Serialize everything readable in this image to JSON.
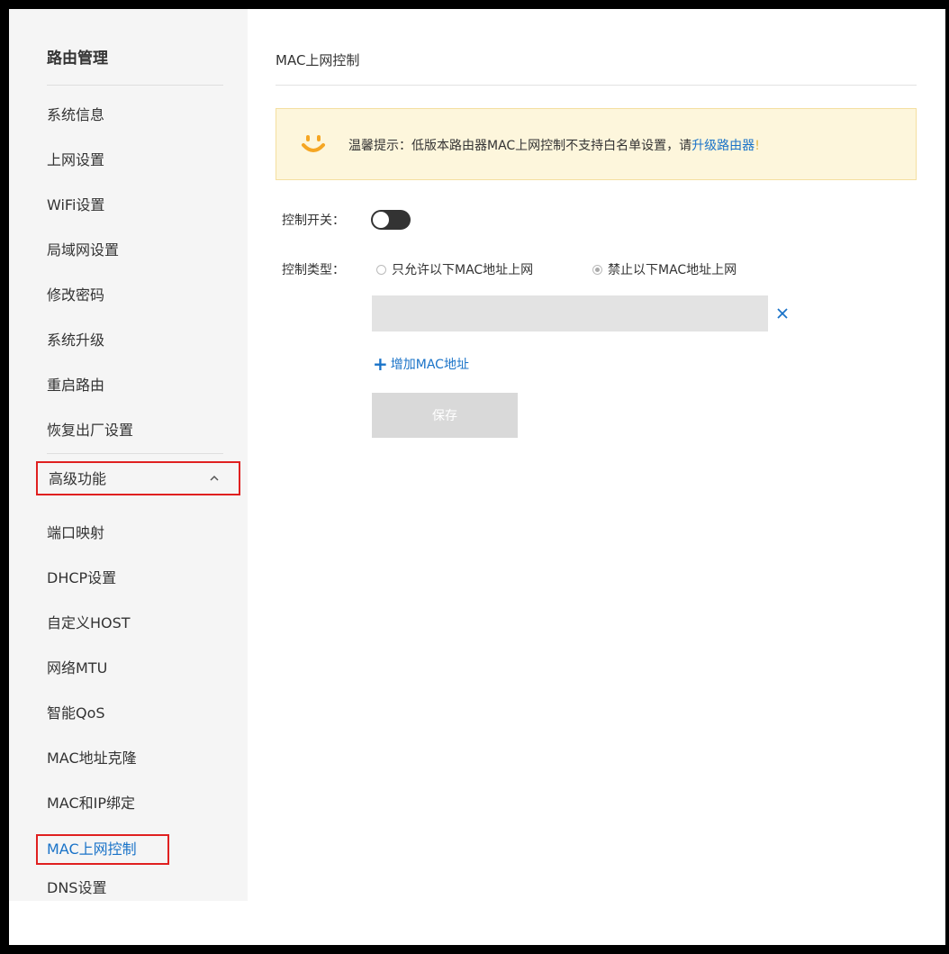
{
  "sidebar": {
    "title": "路由管理",
    "items": [
      {
        "label": "系统信息"
      },
      {
        "label": "上网设置"
      },
      {
        "label": "WiFi设置"
      },
      {
        "label": "局域网设置"
      },
      {
        "label": "修改密码"
      },
      {
        "label": "系统升级"
      },
      {
        "label": "重启路由"
      },
      {
        "label": "恢复出厂设置"
      }
    ],
    "advanced": {
      "label": "高级功能",
      "expanded_icon": "chevron-up-icon",
      "items": [
        {
          "label": "端口映射"
        },
        {
          "label": "DHCP设置"
        },
        {
          "label": "自定义HOST"
        },
        {
          "label": "网络MTU"
        },
        {
          "label": "智能QoS"
        },
        {
          "label": "MAC地址克隆"
        },
        {
          "label": "MAC和IP绑定"
        },
        {
          "label": "MAC上网控制"
        },
        {
          "label": "DNS设置"
        }
      ],
      "active_item": "MAC上网控制"
    }
  },
  "main": {
    "title": "MAC上网控制",
    "tip": {
      "icon": "smile-icon",
      "text": "温馨提示：低版本路由器MAC上网控制不支持白名单设置，请",
      "link": "升级路由器",
      "tail": "!"
    },
    "switch": {
      "label": "控制开关：",
      "on": false
    },
    "control_type": {
      "label": "控制类型：",
      "options": [
        {
          "label": "只允许以下MAC地址上网",
          "checked": false
        },
        {
          "label": "禁止以下MAC地址上网",
          "checked": true
        }
      ]
    },
    "mac_entry": {
      "value": "",
      "remove_icon": "close-icon"
    },
    "add_mac_label": "增加MAC地址",
    "save_label": "保存"
  },
  "colors": {
    "accent": "#1a73c8",
    "highlight_border": "#e02020",
    "tip_background": "#fdf6dc",
    "smile": "#f5a623"
  }
}
